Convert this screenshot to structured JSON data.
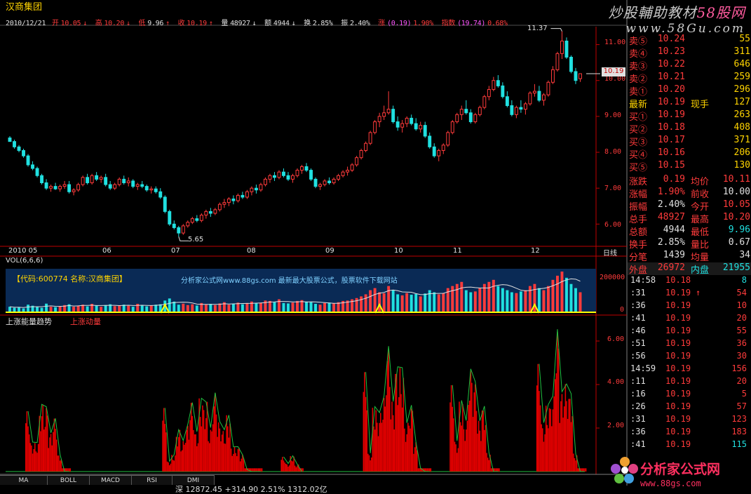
{
  "header": {
    "stock_name": "汉商集团",
    "date": "2010/12/21",
    "open_label": "开",
    "open": "10.05",
    "high_label": "高",
    "high": "10.20",
    "low_label": "低",
    "low": "9.96",
    "close_label": "收",
    "close": "10.19",
    "volume_label": "量",
    "volume": "48927",
    "amount_label": "额",
    "amount": "4944",
    "turnover_label": "换",
    "turnover": "2.85%",
    "amplitude_label": "振",
    "amplitude": "2.40%",
    "change_label": "涨",
    "change": "(0.19)",
    "change_pct": "1.90%",
    "index_label": "指数",
    "index_change": "(19.74)",
    "index_pct": "0.68%"
  },
  "watermark": {
    "line1_a": "炒股輔助教材",
    "line1_b": "58股网",
    "line2": "www.58Gu.com",
    "volume_banner": "分析家公式网www.88gs.com 最新最大股票公式，股票软件下载网站",
    "volume_code": "【代码:600774 名称:汉商集团】",
    "bottom_brand": "分析家公式网",
    "bottom_url": "www.88gs.com"
  },
  "price_panel": {
    "high_marker": "11.37",
    "low_marker": "5.65",
    "current_price_tag": "10.19",
    "y_ticks": [
      "11.00",
      "10.00",
      "9.00",
      "8.00",
      "7.00",
      "6.00"
    ],
    "period_label": "日线",
    "dates": [
      "2010 05",
      "06",
      "07",
      "08",
      "09",
      "10",
      "11",
      "12"
    ]
  },
  "volume_panel": {
    "title": "VOL(6,6,6)",
    "y_ticks": [
      "200000",
      "0"
    ]
  },
  "indicator_panel": {
    "title": "上涨能量趋势",
    "series_name": "上涨动量",
    "y_ticks": [
      "6.00",
      "4.00",
      "2.00"
    ]
  },
  "order_book": {
    "sells": [
      {
        "label": "卖⑤",
        "price": "10.24",
        "vol": "55"
      },
      {
        "label": "卖④",
        "price": "10.23",
        "vol": "311"
      },
      {
        "label": "卖③",
        "price": "10.22",
        "vol": "646"
      },
      {
        "label": "卖②",
        "price": "10.21",
        "vol": "259"
      },
      {
        "label": "卖①",
        "price": "10.20",
        "vol": "296"
      }
    ],
    "latest": {
      "label": "最新",
      "price": "10.19",
      "label2": "现手",
      "vol": "127"
    },
    "buys": [
      {
        "label": "买①",
        "price": "10.19",
        "vol": "263"
      },
      {
        "label": "买②",
        "price": "10.18",
        "vol": "408"
      },
      {
        "label": "买③",
        "price": "10.17",
        "vol": "371"
      },
      {
        "label": "买④",
        "price": "10.16",
        "vol": "206"
      },
      {
        "label": "买⑤",
        "price": "10.15",
        "vol": "130"
      }
    ]
  },
  "stats": [
    {
      "l1": "涨跌",
      "v1": "0.19",
      "l2": "均价",
      "v2": "10.11"
    },
    {
      "l1": "涨幅",
      "v1": "1.90%",
      "l2": "前收",
      "v2": "10.00"
    },
    {
      "l1": "振幅",
      "v1": "2.40%",
      "l2": "今开",
      "v2": "10.05"
    },
    {
      "l1": "总手",
      "v1": "48927",
      "l2": "最高",
      "v2": "10.20"
    },
    {
      "l1": "总额",
      "v1": "4944",
      "l2": "最低",
      "v2": "9.96"
    },
    {
      "l1": "换手",
      "v1": "2.85%",
      "l2": "量比",
      "v2": "0.67"
    },
    {
      "l1": "分笔",
      "v1": "1439",
      "l2": "均量",
      "v2": "34"
    },
    {
      "l1": "外盘",
      "v1": "26972",
      "l2": "内盘",
      "v2": "21955"
    }
  ],
  "ticks": [
    {
      "time": "14:58",
      "price": "10.18",
      "arrow": "",
      "qty": "8",
      "qcolor": "#20e0e0"
    },
    {
      "time": ":31",
      "price": "10.19",
      "arrow": "↑",
      "qty": "54",
      "qcolor": "#ff3b3b"
    },
    {
      "time": ":36",
      "price": "10.19",
      "arrow": "",
      "qty": "10",
      "qcolor": "#ff3b3b"
    },
    {
      "time": ":41",
      "price": "10.19",
      "arrow": "",
      "qty": "20",
      "qcolor": "#ff3b3b"
    },
    {
      "time": ":46",
      "price": "10.19",
      "arrow": "",
      "qty": "55",
      "qcolor": "#ff3b3b"
    },
    {
      "time": ":51",
      "price": "10.19",
      "arrow": "",
      "qty": "36",
      "qcolor": "#ff3b3b"
    },
    {
      "time": ":56",
      "price": "10.19",
      "arrow": "",
      "qty": "30",
      "qcolor": "#ff3b3b"
    },
    {
      "time": "14:59",
      "price": "10.19",
      "arrow": "",
      "qty": "156",
      "qcolor": "#ff3b3b"
    },
    {
      "time": ":11",
      "price": "10.19",
      "arrow": "",
      "qty": "20",
      "qcolor": "#ff3b3b"
    },
    {
      "time": ":16",
      "price": "10.19",
      "arrow": "",
      "qty": "5",
      "qcolor": "#ff3b3b"
    },
    {
      "time": ":26",
      "price": "10.19",
      "arrow": "",
      "qty": "57",
      "qcolor": "#ff3b3b"
    },
    {
      "time": ":31",
      "price": "10.19",
      "arrow": "",
      "qty": "123",
      "qcolor": "#ff3b3b"
    },
    {
      "time": ":36",
      "price": "10.19",
      "arrow": "",
      "qty": "183",
      "qcolor": "#ff3b3b"
    },
    {
      "time": ":41",
      "price": "10.19",
      "arrow": "",
      "qty": "115",
      "qcolor": "#20e0e0"
    }
  ],
  "tabs": [
    "MA",
    "BOLL",
    "MACD",
    "RSI",
    "DMI"
  ],
  "status": {
    "index_text": "深  12872.45  +314.90  2.51%  1312.02亿"
  },
  "colors": {
    "up": "#ff3b3b",
    "down": "#20e0e0",
    "axis": "#c00000",
    "volume_bg": "#0a2a55",
    "accent": "#ffd400"
  },
  "chart_data": {
    "type": "candlestick",
    "price_range": [
      5.4,
      11.5
    ],
    "volume_range": [
      0,
      250000
    ],
    "indicator_range": [
      0,
      7
    ],
    "candles": [
      [
        8.4,
        8.45,
        8.3,
        8.3
      ],
      [
        8.3,
        8.35,
        8.1,
        8.15
      ],
      [
        8.15,
        8.2,
        8.0,
        8.05
      ],
      [
        8.05,
        8.1,
        7.85,
        7.9
      ],
      [
        7.9,
        7.95,
        7.6,
        7.65
      ],
      [
        7.65,
        7.75,
        7.5,
        7.55
      ],
      [
        7.55,
        7.6,
        7.3,
        7.35
      ],
      [
        7.35,
        7.4,
        7.1,
        7.15
      ],
      [
        7.15,
        7.25,
        6.95,
        7.0
      ],
      [
        7.0,
        7.1,
        6.9,
        7.05
      ],
      [
        7.05,
        7.15,
        6.95,
        6.98
      ],
      [
        6.98,
        7.1,
        6.9,
        7.05
      ],
      [
        7.05,
        7.2,
        6.98,
        7.1
      ],
      [
        7.1,
        7.2,
        6.85,
        6.9
      ],
      [
        6.9,
        7.0,
        6.8,
        6.95
      ],
      [
        6.95,
        7.15,
        6.9,
        7.1
      ],
      [
        7.1,
        7.35,
        7.05,
        7.3
      ],
      [
        7.3,
        7.4,
        7.1,
        7.15
      ],
      [
        7.15,
        7.4,
        7.1,
        7.35
      ],
      [
        7.35,
        7.45,
        7.2,
        7.25
      ],
      [
        7.25,
        7.35,
        7.15,
        7.3
      ],
      [
        7.3,
        7.4,
        7.05,
        7.1
      ],
      [
        7.1,
        7.2,
        6.95,
        7.0
      ],
      [
        7.0,
        7.15,
        6.95,
        7.1
      ],
      [
        7.1,
        7.3,
        7.05,
        7.25
      ],
      [
        7.25,
        7.35,
        7.1,
        7.15
      ],
      [
        7.15,
        7.3,
        7.05,
        7.2
      ],
      [
        7.2,
        7.25,
        7.0,
        7.05
      ],
      [
        7.05,
        7.15,
        6.95,
        7.1
      ],
      [
        7.1,
        7.2,
        7.0,
        7.05
      ],
      [
        7.05,
        7.1,
        6.9,
        6.95
      ],
      [
        6.95,
        7.05,
        6.85,
        6.98
      ],
      [
        6.98,
        7.05,
        6.85,
        6.9
      ],
      [
        6.9,
        7.0,
        6.7,
        6.75
      ],
      [
        6.75,
        6.8,
        6.3,
        6.35
      ],
      [
        6.35,
        6.4,
        5.95,
        6.0
      ],
      [
        6.0,
        6.1,
        5.85,
        5.9
      ],
      [
        5.9,
        5.95,
        5.65,
        5.75
      ],
      [
        5.75,
        6.0,
        5.7,
        5.95
      ],
      [
        5.95,
        6.1,
        5.9,
        6.05
      ],
      [
        6.05,
        6.2,
        6.0,
        6.15
      ],
      [
        6.15,
        6.25,
        6.05,
        6.1
      ],
      [
        6.1,
        6.3,
        6.05,
        6.25
      ],
      [
        6.25,
        6.4,
        6.15,
        6.35
      ],
      [
        6.35,
        6.45,
        6.2,
        6.3
      ],
      [
        6.3,
        6.45,
        6.25,
        6.4
      ],
      [
        6.4,
        6.6,
        6.35,
        6.55
      ],
      [
        6.55,
        6.7,
        6.45,
        6.6
      ],
      [
        6.6,
        6.75,
        6.5,
        6.7
      ],
      [
        6.7,
        6.8,
        6.55,
        6.65
      ],
      [
        6.65,
        6.85,
        6.6,
        6.8
      ],
      [
        6.8,
        6.9,
        6.7,
        6.75
      ],
      [
        6.75,
        6.95,
        6.7,
        6.9
      ],
      [
        6.9,
        7.05,
        6.8,
        7.0
      ],
      [
        7.0,
        7.1,
        6.85,
        6.95
      ],
      [
        6.95,
        7.15,
        6.9,
        7.1
      ],
      [
        7.1,
        7.3,
        7.05,
        7.25
      ],
      [
        7.25,
        7.4,
        7.15,
        7.35
      ],
      [
        7.35,
        7.45,
        7.2,
        7.3
      ],
      [
        7.3,
        7.5,
        7.25,
        7.45
      ],
      [
        7.45,
        7.55,
        7.3,
        7.35
      ],
      [
        7.35,
        7.45,
        7.2,
        7.25
      ],
      [
        7.25,
        7.4,
        7.15,
        7.35
      ],
      [
        7.35,
        7.55,
        7.3,
        7.5
      ],
      [
        7.5,
        7.65,
        7.4,
        7.6
      ],
      [
        7.6,
        7.7,
        7.45,
        7.5
      ],
      [
        7.5,
        7.55,
        7.2,
        7.25
      ],
      [
        7.25,
        7.3,
        7.0,
        7.05
      ],
      [
        7.05,
        7.15,
        6.95,
        7.1
      ],
      [
        7.1,
        7.25,
        7.05,
        7.2
      ],
      [
        7.2,
        7.3,
        7.1,
        7.15
      ],
      [
        7.15,
        7.3,
        7.1,
        7.25
      ],
      [
        7.25,
        7.4,
        7.2,
        7.35
      ],
      [
        7.35,
        7.5,
        7.3,
        7.45
      ],
      [
        7.45,
        7.6,
        7.35,
        7.5
      ],
      [
        7.5,
        7.7,
        7.45,
        7.65
      ],
      [
        7.65,
        7.9,
        7.6,
        7.85
      ],
      [
        7.85,
        8.1,
        7.8,
        8.05
      ],
      [
        8.05,
        8.3,
        8.0,
        8.25
      ],
      [
        8.25,
        8.6,
        8.2,
        8.55
      ],
      [
        8.55,
        8.9,
        8.5,
        8.85
      ],
      [
        8.85,
        9.1,
        8.7,
        9.0
      ],
      [
        9.0,
        9.3,
        8.9,
        9.1
      ],
      [
        9.1,
        9.7,
        9.05,
        9.2
      ],
      [
        9.2,
        9.3,
        8.8,
        8.85
      ],
      [
        8.85,
        9.0,
        8.6,
        8.7
      ],
      [
        8.7,
        8.9,
        8.55,
        8.8
      ],
      [
        8.8,
        9.0,
        8.7,
        8.95
      ],
      [
        8.95,
        9.05,
        8.75,
        8.8
      ],
      [
        8.8,
        8.95,
        8.6,
        8.65
      ],
      [
        8.65,
        8.85,
        8.55,
        8.75
      ],
      [
        8.75,
        8.85,
        8.4,
        8.45
      ],
      [
        8.45,
        8.55,
        8.1,
        8.15
      ],
      [
        8.15,
        8.25,
        7.85,
        7.9
      ],
      [
        7.9,
        8.1,
        7.75,
        8.05
      ],
      [
        8.05,
        8.25,
        7.95,
        8.2
      ],
      [
        8.2,
        8.6,
        8.15,
        8.55
      ],
      [
        8.55,
        8.9,
        8.5,
        8.85
      ],
      [
        8.85,
        9.1,
        8.8,
        9.05
      ],
      [
        9.05,
        9.3,
        8.9,
        9.2
      ],
      [
        9.2,
        9.45,
        9.05,
        9.1
      ],
      [
        9.1,
        9.2,
        8.8,
        8.85
      ],
      [
        8.85,
        9.1,
        8.8,
        9.05
      ],
      [
        9.05,
        9.3,
        9.0,
        9.25
      ],
      [
        9.25,
        9.6,
        9.2,
        9.55
      ],
      [
        9.55,
        9.85,
        9.45,
        9.75
      ],
      [
        9.75,
        10.1,
        9.7,
        10.0
      ],
      [
        10.0,
        10.15,
        9.8,
        9.85
      ],
      [
        9.85,
        9.95,
        9.5,
        9.55
      ],
      [
        9.55,
        9.7,
        9.25,
        9.3
      ],
      [
        9.3,
        9.45,
        9.0,
        9.05
      ],
      [
        9.05,
        9.3,
        8.95,
        9.25
      ],
      [
        9.25,
        9.45,
        9.1,
        9.2
      ],
      [
        9.2,
        9.4,
        9.05,
        9.35
      ],
      [
        9.35,
        9.7,
        9.3,
        9.65
      ],
      [
        9.65,
        9.9,
        9.55,
        9.7
      ],
      [
        9.7,
        9.85,
        9.4,
        9.45
      ],
      [
        9.45,
        9.65,
        9.3,
        9.6
      ],
      [
        9.6,
        10.0,
        9.55,
        9.95
      ],
      [
        9.95,
        10.4,
        9.9,
        10.3
      ],
      [
        10.3,
        10.8,
        10.25,
        10.75
      ],
      [
        10.75,
        11.37,
        10.6,
        11.1
      ],
      [
        11.1,
        11.2,
        10.6,
        10.65
      ],
      [
        10.65,
        10.7,
        10.2,
        10.25
      ],
      [
        10.25,
        10.35,
        9.9,
        10.0
      ],
      [
        10.05,
        10.2,
        9.96,
        10.19
      ]
    ],
    "volume_max": 200000,
    "volumes": [
      30,
      25,
      28,
      22,
      40,
      35,
      30,
      25,
      45,
      30,
      28,
      33,
      38,
      42,
      30,
      36,
      40,
      32,
      44,
      35,
      30,
      38,
      42,
      33,
      36,
      40,
      35,
      30,
      44,
      38,
      32,
      36,
      40,
      42,
      60,
      70,
      55,
      40,
      45,
      38,
      42,
      36,
      48,
      40,
      44,
      38,
      46,
      52,
      40,
      44,
      50,
      42,
      48,
      55,
      46,
      50,
      60,
      58,
      52,
      66,
      48,
      46,
      50,
      58,
      62,
      55,
      52,
      44,
      40,
      48,
      50,
      46,
      52,
      58,
      60,
      66,
      72,
      80,
      90,
      110,
      120,
      100,
      95,
      130,
      110,
      90,
      85,
      96,
      88,
      92,
      80,
      94,
      110,
      100,
      90,
      96,
      120,
      130,
      140,
      150,
      110,
      100,
      104,
      120,
      140,
      150,
      160,
      130,
      120,
      110,
      100,
      96,
      104,
      110,
      130,
      140,
      120,
      110,
      130,
      160,
      180,
      210,
      170,
      140,
      120,
      100
    ],
    "indicator_blocks": [
      {
        "start": 4,
        "end": 13,
        "peak": 3.7
      },
      {
        "start": 34,
        "end": 55,
        "peak": 3.9
      },
      {
        "start": 60,
        "end": 64,
        "peak": 0.9
      },
      {
        "start": 78,
        "end": 92,
        "peak": 6.1
      },
      {
        "start": 97,
        "end": 107,
        "peak": 5.3
      },
      {
        "start": 116,
        "end": 126,
        "peak": 6.6
      }
    ]
  }
}
